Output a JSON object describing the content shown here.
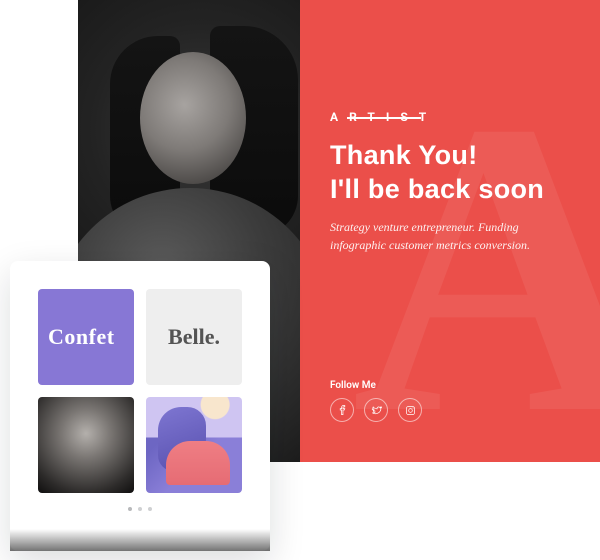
{
  "colors": {
    "red": "#eb4f4a",
    "purple_tile": "#8777d5",
    "grey_tile": "#eeeeee"
  },
  "portrait": {
    "alt": "Black and white portrait of a woman in a hoodie"
  },
  "hero": {
    "bg_letter": "A",
    "brand_plain_left": "A",
    "brand_strike": "RTIS",
    "brand_plain_right": "T",
    "heading_l1": "Thank You!",
    "heading_l2": "I'll be back soon",
    "subtitle": "Strategy venture entrepreneur. Funding infographic customer metrics conversion.",
    "follow_label": "Follow Me",
    "socials": [
      {
        "name": "facebook"
      },
      {
        "name": "twitter"
      },
      {
        "name": "instagram"
      }
    ]
  },
  "gallery": {
    "tiles": {
      "confetti_label": "Confet",
      "belle_label": "Belle.",
      "bw_alt": "BW portrait thumbnail",
      "illus_alt": "Purple illustration of a woman"
    },
    "dots_count": 3,
    "active_dot": 0
  }
}
